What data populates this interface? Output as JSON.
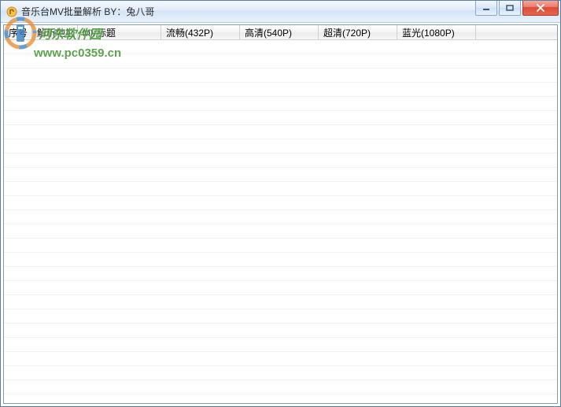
{
  "window": {
    "title": "音乐台MV批量解析 BY：兔八哥"
  },
  "columns": {
    "c0": "序号",
    "c1": "解析地址",
    "c2": "MV标题",
    "c3": "流畅(432P)",
    "c4": "高清(540P)",
    "c5": "超清(720P)",
    "c6": "蓝光(1080P)"
  },
  "watermark": {
    "line1": "河东软件园",
    "line2": "www.pc0359.cn"
  }
}
